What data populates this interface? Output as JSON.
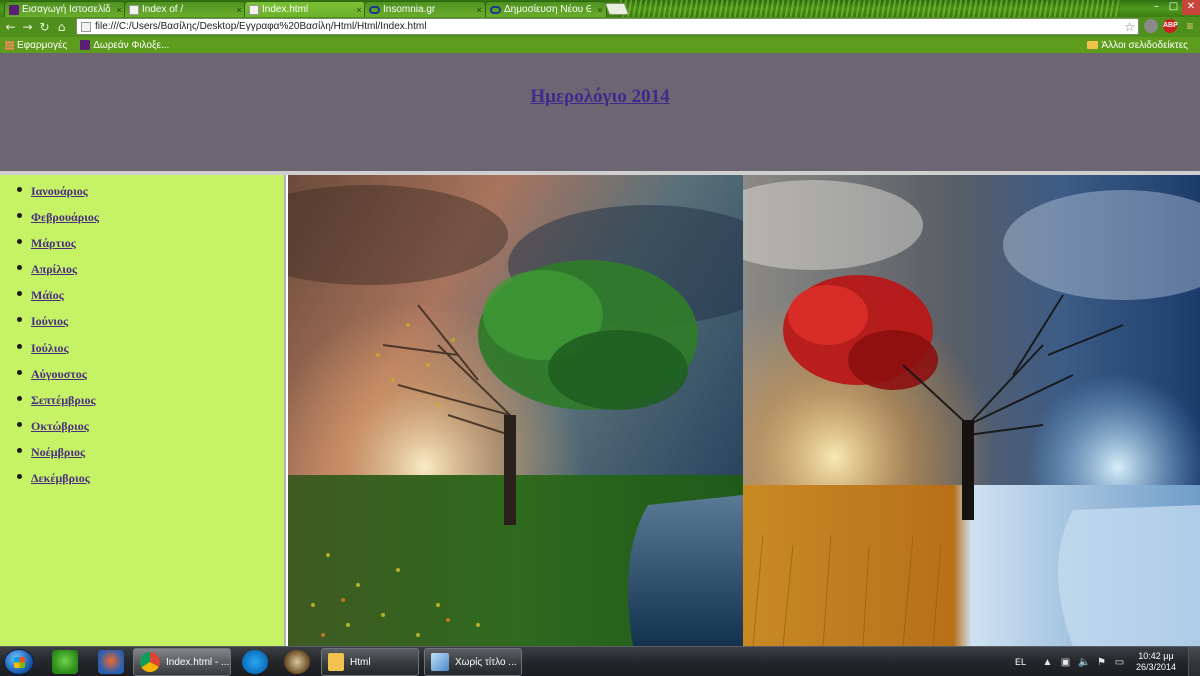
{
  "browser": {
    "tabs": [
      {
        "title": "Εισαγωγή Ιστοσελίδ",
        "icon": "site-logo-icon",
        "active": false
      },
      {
        "title": "Index of /",
        "icon": "page-icon",
        "active": false
      },
      {
        "title": "Index.html",
        "icon": "page-icon",
        "active": true
      },
      {
        "title": "Insomnia.gr",
        "icon": "glasses-icon",
        "active": false
      },
      {
        "title": "Δημοσίευση Νέου Θ",
        "icon": "glasses-icon",
        "active": false
      }
    ],
    "tab_close_glyph": "×",
    "window_controls": {
      "minimize": "–",
      "maximize": "□",
      "close": "✕"
    },
    "address_url": "file:///C:/Users/Βασίλης/Desktop/Εγγραφα%20Βασίλη/Html/Html/Index.html",
    "extensions": {
      "abp": "ABP"
    },
    "bookmarks": {
      "apps": "Εφαρμογές",
      "item": "Δωρεάν Φιλοξε...",
      "other": "Άλλοι σελιδοδείκτες"
    }
  },
  "page": {
    "title": "Ημερολόγιο 2014",
    "months": [
      "Ιανουάριος",
      "Φεβρουάριος",
      "Μάρτιος",
      "Απρίλιος",
      "Μάϊος",
      "Ιούνιος",
      "Ιούλιος",
      "Αύγουστος",
      "Σεπτέμβριος",
      "Οκτώβριος",
      "Νοέμβριος",
      "Δεκέμβριος"
    ],
    "colors": {
      "header_bg": "#6c6673",
      "sidebar_bg": "#c6f266",
      "link": "#4a2f80"
    }
  },
  "taskbar": {
    "tasks": [
      {
        "label": "Index.html - ...",
        "active": true
      },
      {
        "label": "Html",
        "active": false
      },
      {
        "label": "Χωρίς τίτλο ...",
        "active": false
      }
    ],
    "tray": {
      "language": "EL",
      "time": "10:42 μμ",
      "date": "26/3/2014"
    }
  }
}
